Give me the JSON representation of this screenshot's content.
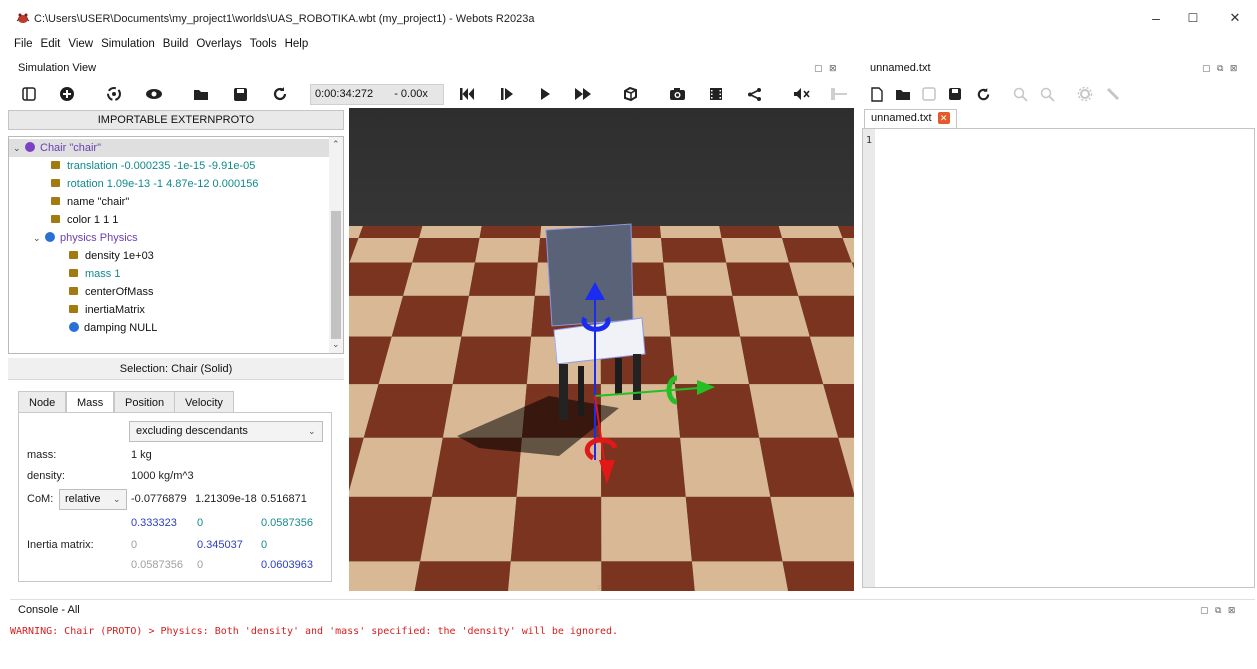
{
  "window": {
    "title": "C:\\Users\\USER\\Documents\\my_project1\\worlds\\UAS_ROBOTIKA.wbt (my_project1) - Webots R2023a",
    "minimize": "–",
    "maximize": "☐",
    "close": "✕"
  },
  "menu": [
    "File",
    "Edit",
    "View",
    "Simulation",
    "Build",
    "Overlays",
    "Tools",
    "Help"
  ],
  "simulation_view": {
    "title": "Simulation View",
    "time": "0:00:34:272",
    "speed": "-  0.00x"
  },
  "toolbar_icons": [
    "sidebar-toggle-icon",
    "add-node-icon",
    "orbit-icon",
    "eye-icon",
    "open-folder-icon",
    "save-icon",
    "reload-icon",
    "step-back-icon",
    "step-icon",
    "play-icon",
    "fast-forward-icon",
    "cube-icon",
    "screenshot-icon",
    "record-icon",
    "share-icon",
    "mute-icon",
    "volume-slider-icon"
  ],
  "importable_button": "IMPORTABLE EXTERNPROTO",
  "tree": {
    "root": "Chair \"chair\"",
    "fields": [
      {
        "label": "translation -0.000235 -1e-15 -9.91e-05",
        "style": "teal"
      },
      {
        "label": "rotation 1.09e-13 -1 4.87e-12 0.000156",
        "style": "teal"
      },
      {
        "label": "name \"chair\"",
        "style": "plain"
      },
      {
        "label": "color 1 1 1",
        "style": "plain"
      }
    ],
    "physics": "physics Physics",
    "physics_fields": [
      {
        "label": "density 1e+03",
        "style": "plain"
      },
      {
        "label": "mass 1",
        "style": "teal"
      },
      {
        "label": "centerOfMass",
        "style": "plain"
      },
      {
        "label": "inertiaMatrix",
        "style": "plain"
      }
    ],
    "damping": "damping NULL"
  },
  "selection": {
    "title": "Selection: Chair (Solid)",
    "tabs": [
      "Node",
      "Mass",
      "Position",
      "Velocity"
    ],
    "active_tab": "Mass",
    "mode": "excluding descendants",
    "mass_label": "mass:",
    "mass_value": "1 kg",
    "density_label": "density:",
    "density_value": "1000 kg/m^3",
    "com_label": "CoM:",
    "com_mode": "relative",
    "com_values": [
      "-0.0776879",
      "1.21309e-18",
      "0.516871"
    ],
    "inertia_row1": [
      "0.333323",
      "0",
      "0.0587356"
    ],
    "inertia_label": "Inertia matrix:",
    "inertia_row2": [
      "0",
      "0.345037",
      "0"
    ],
    "inertia_row3": [
      "0.0587356",
      "0",
      "0.0603963"
    ]
  },
  "editor": {
    "panel_title": "unnamed.txt",
    "tab_label": "unnamed.txt",
    "line_number": "1"
  },
  "console": {
    "title": "Console - All",
    "message": "WARNING: Chair (PROTO) > Physics: Both 'density' and 'mass' specified: the 'density' will be ignored."
  },
  "colors": {
    "warning": "#d42020",
    "accent_blue": "#2b3fbf",
    "teal_field": "#108a8a"
  }
}
